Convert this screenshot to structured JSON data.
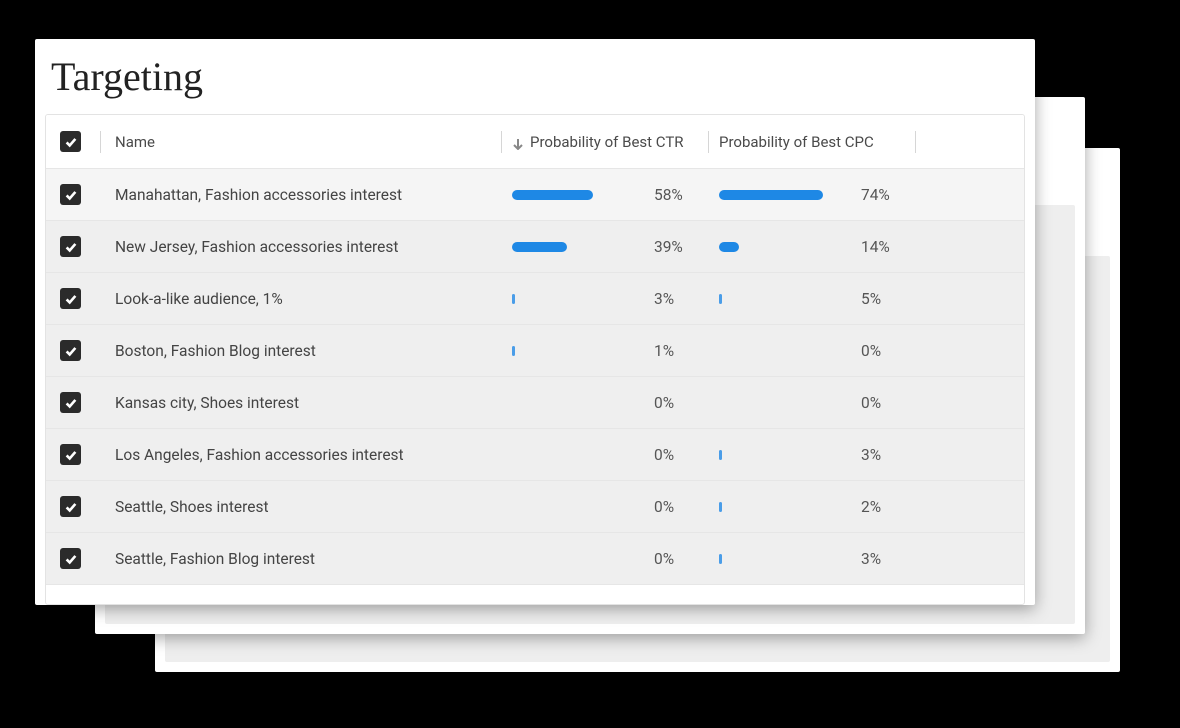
{
  "title": "Targeting",
  "columns": {
    "name": "Name",
    "ctr": "Probability of Best CTR",
    "cpc": "Probability of Best CPC"
  },
  "chart_data": {
    "type": "table",
    "columns": [
      "Name",
      "Probability of Best CTR",
      "Probability of Best CPC"
    ],
    "rows": [
      {
        "name": "Manahattan, Fashion accessories interest",
        "ctr": 58,
        "cpc": 74
      },
      {
        "name": "New Jersey, Fashion accessories interest",
        "ctr": 39,
        "cpc": 14
      },
      {
        "name": "Look-a-like audience, 1%",
        "ctr": 3,
        "cpc": 5
      },
      {
        "name": "Boston, Fashion Blog interest",
        "ctr": 1,
        "cpc": 0
      },
      {
        "name": "Kansas city, Shoes interest",
        "ctr": 0,
        "cpc": 0
      },
      {
        "name": "Los Angeles, Fashion accessories interest",
        "ctr": 0,
        "cpc": 3
      },
      {
        "name": "Seattle, Shoes interest",
        "ctr": 0,
        "cpc": 2
      },
      {
        "name": "Seattle, Fashion Blog interest",
        "ctr": 0,
        "cpc": 3
      }
    ]
  }
}
